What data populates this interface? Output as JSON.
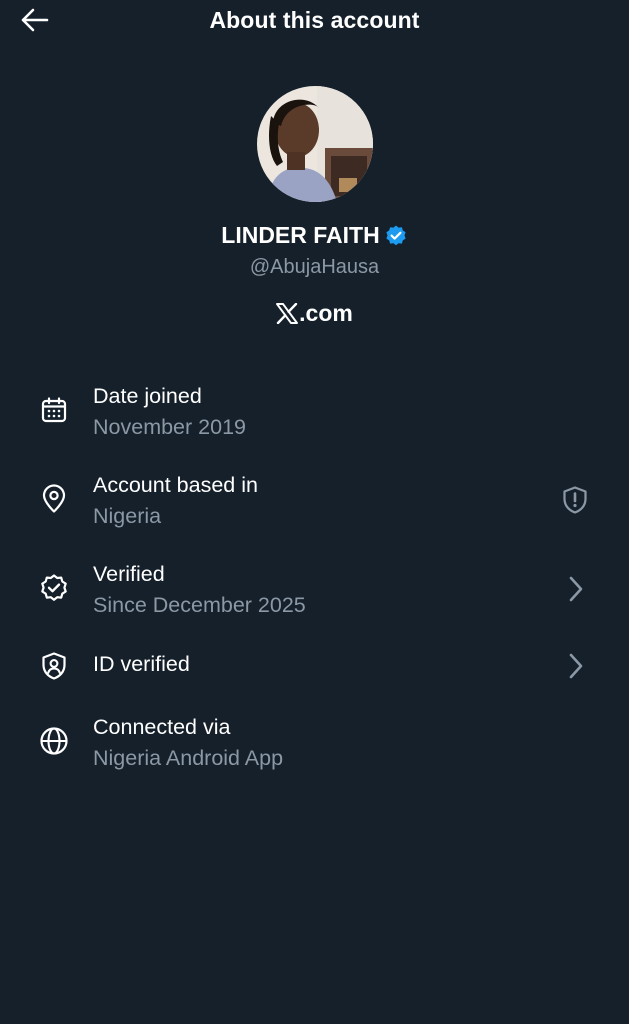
{
  "header": {
    "title": "About this account",
    "back_icon": "back-arrow-icon"
  },
  "profile": {
    "display_name": "LINDER FAITH",
    "handle": "@AbujaHausa",
    "verified_badge_color": "#1d9bf0",
    "site": ".com",
    "site_logo": "x-logo-icon"
  },
  "rows": [
    {
      "icon": "calendar-icon",
      "title": "Date joined",
      "subtitle": "November 2019"
    },
    {
      "icon": "location-pin-icon",
      "title": "Account based in",
      "subtitle": "Nigeria",
      "trailing_icon": "shield-alert-icon"
    },
    {
      "icon": "verified-check-icon",
      "title": "Verified",
      "subtitle": "Since December 2025",
      "trailing_icon": "chevron-right-icon"
    },
    {
      "icon": "id-shield-icon",
      "title": "ID verified",
      "trailing_icon": "chevron-right-icon"
    },
    {
      "icon": "globe-icon",
      "title": "Connected via",
      "subtitle": "Nigeria Android App"
    }
  ],
  "colors": {
    "background": "#15202b",
    "primary_text": "#ffffff",
    "secondary_text": "#8b98a5"
  }
}
